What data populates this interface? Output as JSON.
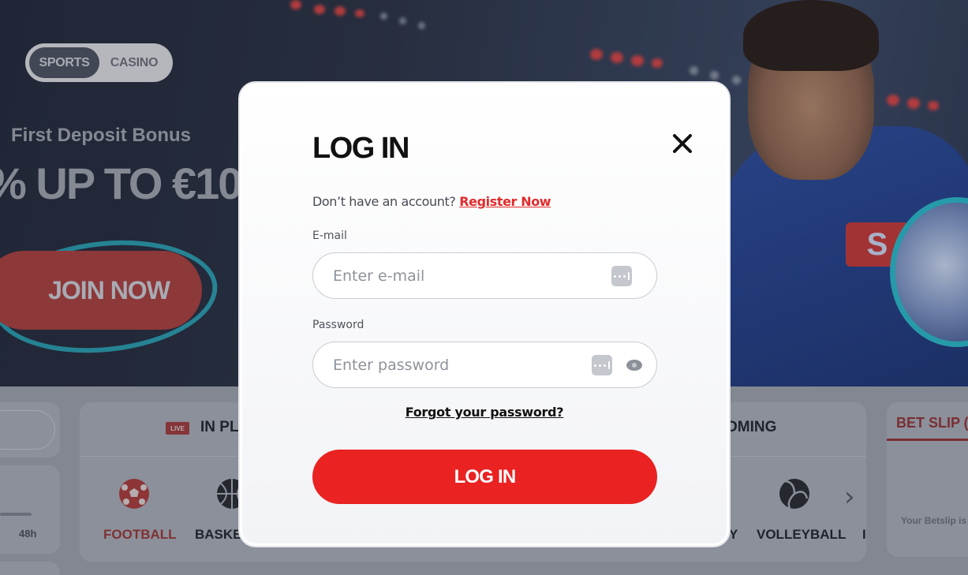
{
  "hero": {
    "toggle": {
      "sports_label": "SPORTS",
      "casino_label": "CASINO"
    },
    "bonus_subtitle": "First Deposit Bonus",
    "bonus_headline": "% UP TO €10",
    "join_label": "JOIN NOW",
    "shirt_logo": "S"
  },
  "sports_strip": {
    "filter_48h": "48h",
    "live_badge": "LIVE",
    "in_play_label": "IN PLA",
    "upcoming_label": "OMING",
    "sports": [
      "FOOTBALL",
      "BASKET",
      "Y",
      "VOLLEYBALL",
      "I"
    ],
    "active_sport": "FOOTBALL"
  },
  "betslip": {
    "title": "BET SLIP (C",
    "empty_text": "Your Betslip is"
  },
  "login_modal": {
    "title": "LOG IN",
    "close_icon": "close-icon",
    "signup_prompt": "Don’t have an account?",
    "register_link": "Register Now",
    "email_label": "E-mail",
    "email_placeholder": "Enter e-mail",
    "password_label": "Password",
    "password_placeholder": "Enter password",
    "forgot_link": "Forgot your password?",
    "submit_label": "LOG IN"
  },
  "colors": {
    "accent_red": "#ea2222",
    "link_red": "#e12b2b",
    "teal_scribble": "#2bb7c9"
  }
}
